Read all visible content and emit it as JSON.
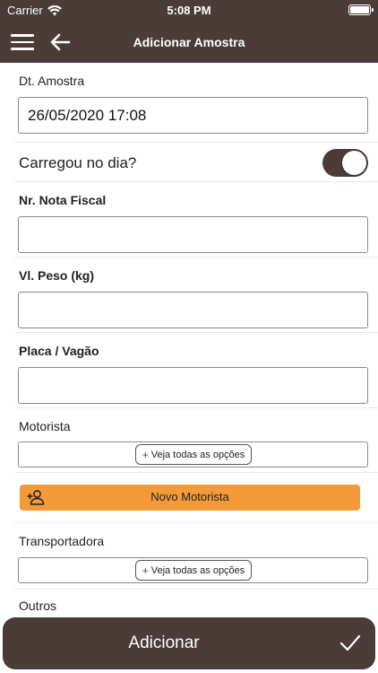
{
  "status_bar": {
    "carrier": "Carrier",
    "time": "5:08 PM"
  },
  "nav": {
    "title": "Adicionar Amostra"
  },
  "form": {
    "dt_amostra": {
      "label": "Dt. Amostra",
      "value": "26/05/2020 17:08"
    },
    "carregou": {
      "label": "Carregou no dia?",
      "on": true
    },
    "nota_fiscal": {
      "label": "Nr. Nota Fiscal",
      "value": ""
    },
    "peso": {
      "label": "Vl. Peso (kg)",
      "value": ""
    },
    "placa": {
      "label": "Placa / Vagão",
      "value": ""
    },
    "motorista": {
      "label": "Motorista",
      "options_button": "Veja todas as opções"
    },
    "novo_motorista": {
      "label": "Novo Motorista"
    },
    "transportadora": {
      "label": "Transportadora",
      "options_button": "Veja todas as opções"
    },
    "outros": {
      "label": "Outros"
    }
  },
  "submit": {
    "label": "Adicionar"
  },
  "colors": {
    "brand_dark": "#4b3c37",
    "accent_orange": "#f59a3b"
  },
  "icons": [
    "wifi-icon",
    "battery-icon",
    "menu-icon",
    "back-arrow-icon",
    "plus-icon",
    "add-person-icon",
    "checkmark-icon"
  ]
}
